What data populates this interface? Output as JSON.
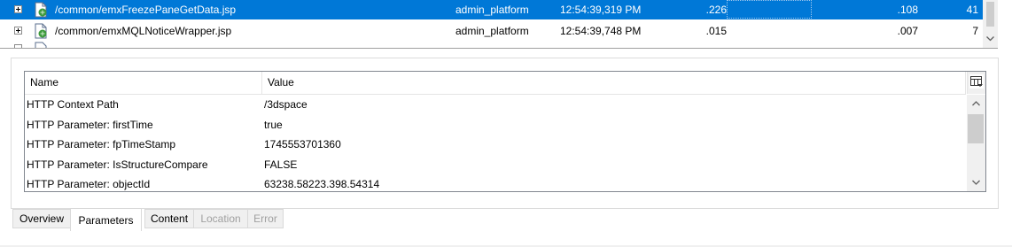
{
  "tree": {
    "rows": [
      {
        "path": "/common/emxFreezePaneGetData.jsp",
        "user": "admin_platform",
        "time": "12:54:39,319 PM",
        "v1": ".226",
        "v2": ".108",
        "v3": "41",
        "selected": true
      },
      {
        "path": "/common/emxMQLNoticeWrapper.jsp",
        "user": "admin_platform",
        "time": "12:54:39,748 PM",
        "v1": ".015",
        "v2": ".007",
        "v3": "7",
        "selected": false
      }
    ]
  },
  "grid": {
    "headers": {
      "name": "Name",
      "value": "Value"
    },
    "rows": [
      {
        "name": "HTTP Context Path",
        "value": "/3dspace"
      },
      {
        "name": "HTTP Parameter: firstTime",
        "value": "true"
      },
      {
        "name": "HTTP Parameter: fpTimeStamp",
        "value": "1745553701360"
      },
      {
        "name": "HTTP Parameter: IsStructureCompare",
        "value": "FALSE"
      },
      {
        "name": "HTTP Parameter: objectId",
        "value": "63238.58223.398.54314"
      }
    ]
  },
  "tabs": [
    {
      "label": "Overview",
      "state": "normal"
    },
    {
      "label": "Parameters",
      "state": "active"
    },
    {
      "label": "Content",
      "state": "normal"
    },
    {
      "label": "Location",
      "state": "disabled"
    },
    {
      "label": "Error",
      "state": "disabled"
    }
  ],
  "colors": {
    "selection": "#0078d7",
    "disabled_text": "#a0a0a0"
  }
}
